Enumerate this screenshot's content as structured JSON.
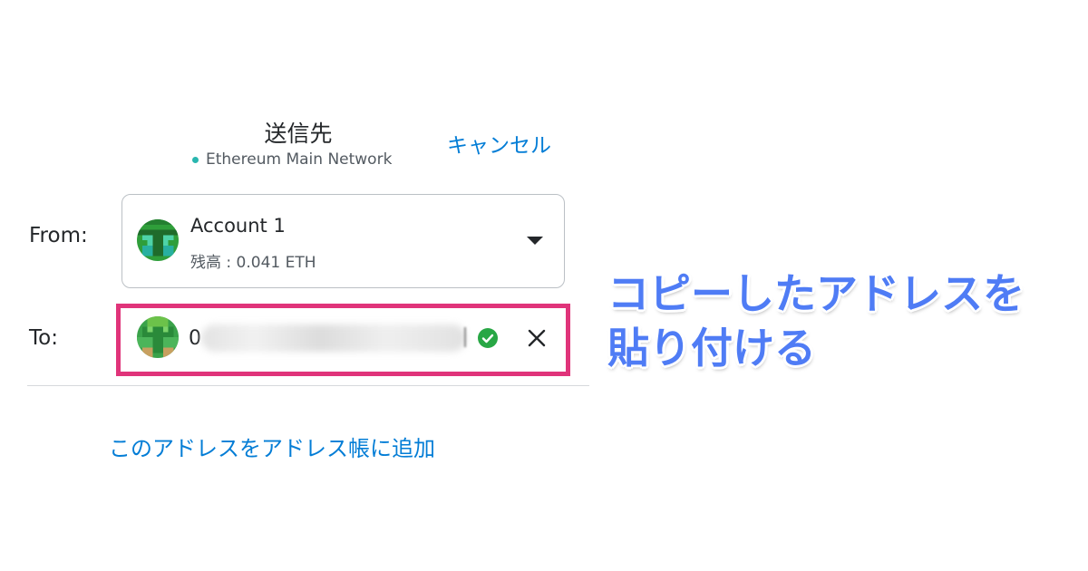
{
  "header": {
    "title": "送信先",
    "network": "Ethereum Main Network",
    "cancel_label": "キャンセル"
  },
  "from": {
    "label": "From:",
    "account_name": "Account 1",
    "balance": "残高 : 0.041 ETH"
  },
  "to": {
    "label": "To:",
    "address_value": "0"
  },
  "add_to_address_book_label": "このアドレスをアドレス帳に追加",
  "annotation": {
    "line1": "コピーしたアドレスを",
    "line2": "貼り付ける"
  },
  "colors": {
    "link": "#037dd6",
    "highlight_border": "#e0347a",
    "annotation_text": "#4f7cf5",
    "valid_check": "#28a745",
    "network_dot": "#29b6af"
  }
}
